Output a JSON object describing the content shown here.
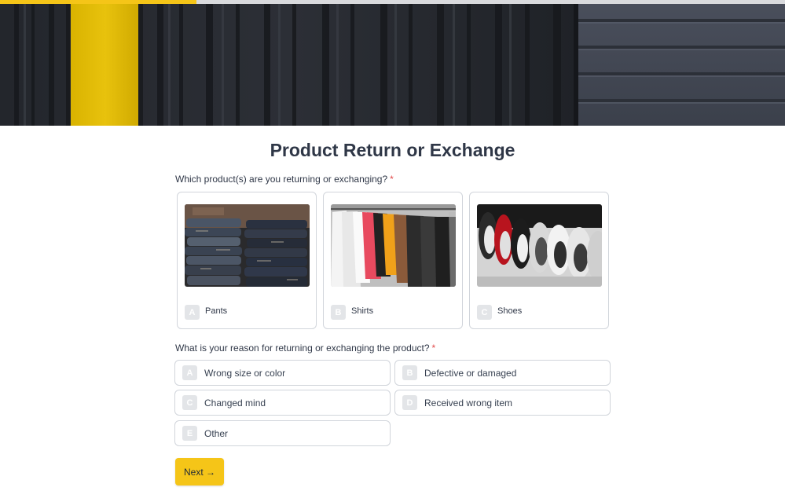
{
  "progress": {
    "fraction": 0.25
  },
  "form": {
    "title": "Product Return or Exchange",
    "q1": {
      "text": "Which product(s) are you returning or exchanging?",
      "required_mark": "*",
      "options": [
        {
          "key": "A",
          "label": "Pants",
          "image": "stacked-jeans"
        },
        {
          "key": "B",
          "label": "Shirts",
          "image": "hanging-shirts"
        },
        {
          "key": "C",
          "label": "Shoes",
          "image": "sneakers-row"
        }
      ]
    },
    "q2": {
      "text": "What is your reason for returning or exchanging the product?",
      "required_mark": "*",
      "options": [
        {
          "key": "A",
          "label": "Wrong size or color"
        },
        {
          "key": "B",
          "label": "Defective or damaged"
        },
        {
          "key": "C",
          "label": "Changed mind"
        },
        {
          "key": "D",
          "label": "Received wrong item"
        },
        {
          "key": "E",
          "label": "Other"
        }
      ]
    },
    "next_label": "Next →"
  },
  "colors": {
    "accent": "#f5c518",
    "border": "#d1d5db",
    "text": "#2f3747",
    "required": "#e24a4a"
  }
}
